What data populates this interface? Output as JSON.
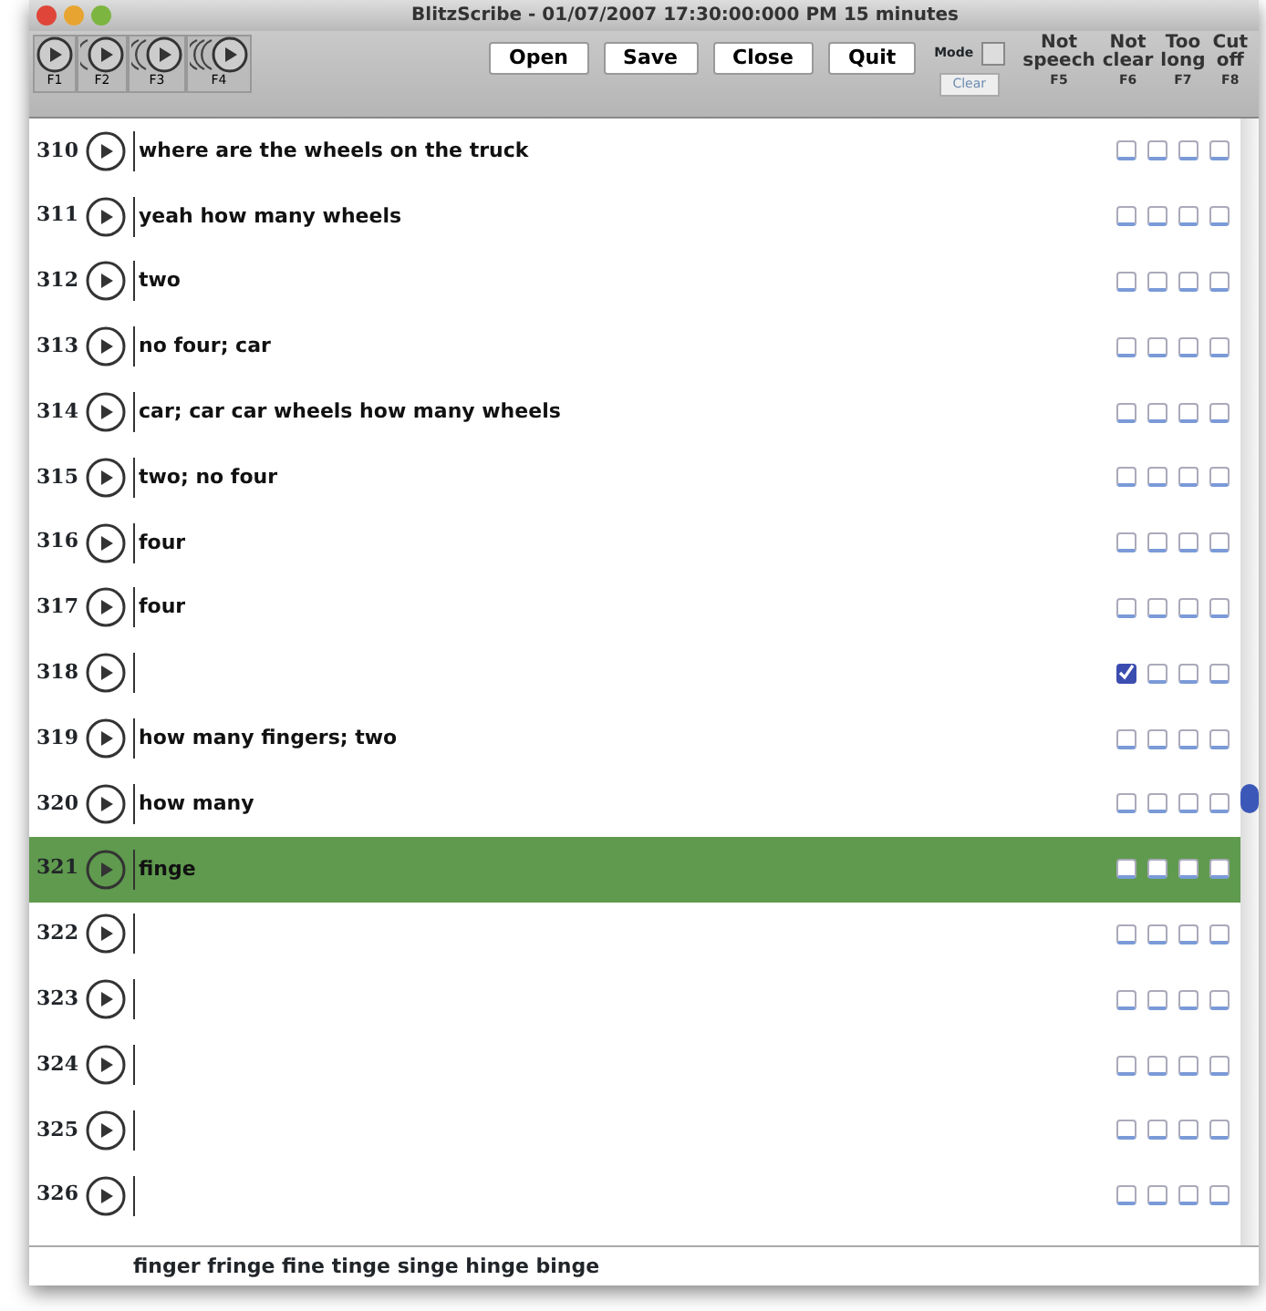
{
  "window": {
    "title": "BlitzScribe - 01/07/2007 17:30:00:000 PM 15 minutes"
  },
  "toolbar": {
    "play_buttons": [
      {
        "kind": "plain",
        "label": "F1"
      },
      {
        "kind": "echo1",
        "label": "F2"
      },
      {
        "kind": "echo2",
        "label": "F3"
      },
      {
        "kind": "echo3",
        "label": "F4"
      }
    ],
    "buttons": [
      "Open",
      "Save",
      "Close",
      "Quit"
    ],
    "mode": {
      "label": "Mode",
      "checked": false
    },
    "clear_button": "Clear",
    "columns": [
      {
        "label": "Not speech",
        "key": "F5"
      },
      {
        "label": "Not clear",
        "key": "F6"
      },
      {
        "label": "Too long",
        "key": "F7"
      },
      {
        "label": "Cut off",
        "key": "F8"
      }
    ]
  },
  "rows": [
    {
      "number": "310",
      "text": "where are the wheels on the truck",
      "flags": [
        false,
        false,
        false,
        false
      ],
      "selected": false
    },
    {
      "number": "311",
      "text": "yeah how many wheels",
      "flags": [
        false,
        false,
        false,
        false
      ],
      "selected": false
    },
    {
      "number": "312",
      "text": "two",
      "flags": [
        false,
        false,
        false,
        false
      ],
      "selected": false
    },
    {
      "number": "313",
      "text": "no four; car",
      "flags": [
        false,
        false,
        false,
        false
      ],
      "selected": false
    },
    {
      "number": "314",
      "text": "car; car car wheels how many wheels",
      "flags": [
        false,
        false,
        false,
        false
      ],
      "selected": false
    },
    {
      "number": "315",
      "text": "two; no four",
      "flags": [
        false,
        false,
        false,
        false
      ],
      "selected": false
    },
    {
      "number": "316",
      "text": "four",
      "flags": [
        false,
        false,
        false,
        false
      ],
      "selected": false
    },
    {
      "number": "317",
      "text": "four",
      "flags": [
        false,
        false,
        false,
        false
      ],
      "selected": false
    },
    {
      "number": "318",
      "flags": [
        true,
        false,
        false,
        false
      ],
      "selected": false
    },
    {
      "number": "319",
      "text": "how many fingers; two",
      "flags": [
        false,
        false,
        false,
        false
      ],
      "selected": false
    },
    {
      "number": "320",
      "text": "how many",
      "flags": [
        false,
        false,
        false,
        false
      ],
      "selected": false
    },
    {
      "number": "321",
      "text": "finge",
      "flags": [
        false,
        false,
        false,
        false
      ],
      "selected": true
    },
    {
      "number": "322",
      "flags": [
        false,
        false,
        false,
        false
      ],
      "selected": false
    },
    {
      "number": "323",
      "flags": [
        false,
        false,
        false,
        false
      ],
      "selected": false
    },
    {
      "number": "324",
      "flags": [
        false,
        false,
        false,
        false
      ],
      "selected": false
    },
    {
      "number": "325",
      "flags": [
        false,
        false,
        false,
        false
      ],
      "selected": false
    },
    {
      "number": "326",
      "flags": [
        false,
        false,
        false,
        false
      ],
      "selected": false
    }
  ],
  "suggestions": "finger fringe fine tinge singe hinge binge"
}
